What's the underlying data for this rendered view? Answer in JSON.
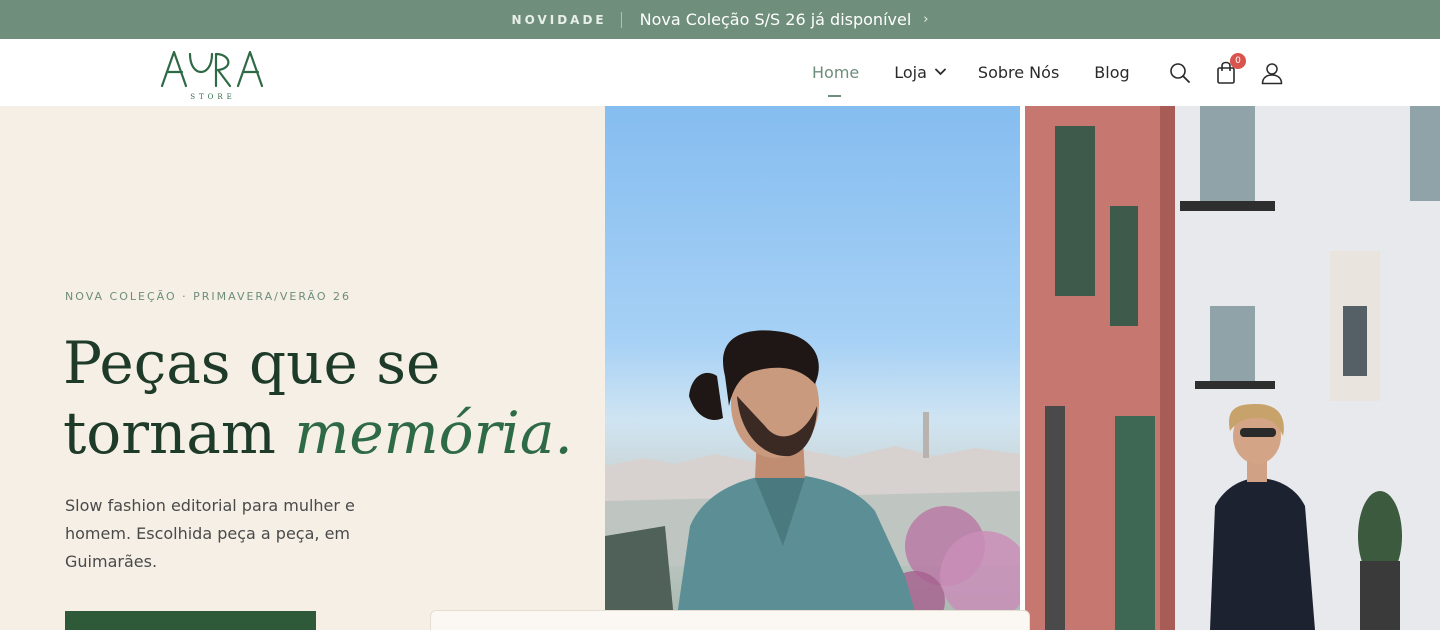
{
  "announcement": {
    "tag": "NOVIDADE",
    "message": "Nova Coleção S/S 26 já disponível",
    "chevron": "›",
    "background": "#6f8f7c"
  },
  "header": {
    "logo": {
      "wordmark": "AURA",
      "subtitle": "STORE"
    },
    "nav": [
      {
        "label": "Home",
        "active": true
      },
      {
        "label": "Loja",
        "has_dropdown": true,
        "caret": "⌄"
      },
      {
        "label": "Sobre Nós"
      },
      {
        "label": "Blog"
      }
    ],
    "icons": {
      "search": "search-icon",
      "cart": "cart-icon",
      "account": "user-icon"
    },
    "cart_count": "0",
    "accent_color": "#6e8d7b",
    "badge_color": "#d9534f"
  },
  "hero": {
    "eyebrow": "NOVA COLEÇÃO · PRIMAVERA/VERÃO 26",
    "headline_line1": "Peças que se",
    "headline_line2_plain": "tornam ",
    "headline_line2_emphasis": "memória.",
    "lede": "Slow fashion editorial para mulher e homem. Escolhida peça a peça, em Guimarães.",
    "background": "#f5efe6",
    "cta_color": "#2f5a3a"
  }
}
